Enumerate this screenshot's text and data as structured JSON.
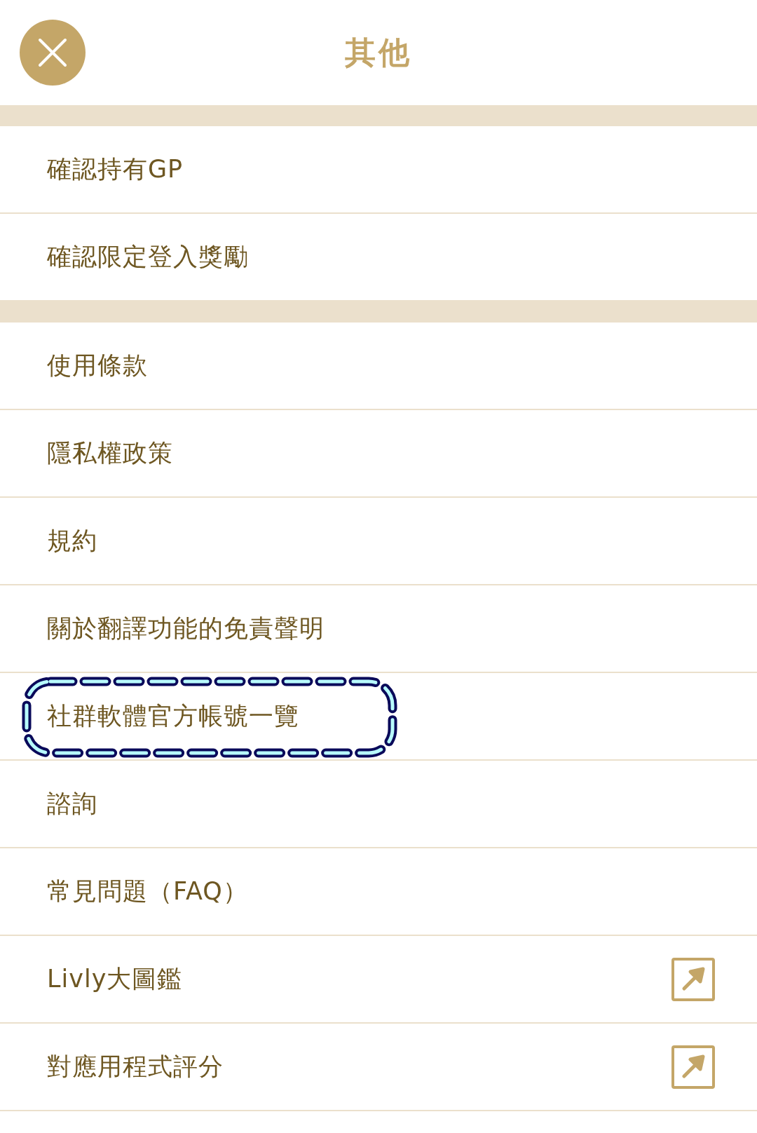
{
  "header": {
    "title": "其他"
  },
  "sections": [
    {
      "items": [
        {
          "label": "確認持有GP",
          "external": false,
          "highlighted": false
        },
        {
          "label": "確認限定登入獎勵",
          "external": false,
          "highlighted": false
        }
      ]
    },
    {
      "items": [
        {
          "label": "使用條款",
          "external": false,
          "highlighted": false
        },
        {
          "label": "隱私權政策",
          "external": false,
          "highlighted": false
        },
        {
          "label": "規約",
          "external": false,
          "highlighted": false
        },
        {
          "label": "關於翻譯功能的免責聲明",
          "external": false,
          "highlighted": false
        },
        {
          "label": "社群軟體官方帳號一覽",
          "external": false,
          "highlighted": true
        },
        {
          "label": "諮詢",
          "external": false,
          "highlighted": false
        },
        {
          "label": "常見問題（FAQ）",
          "external": false,
          "highlighted": false
        },
        {
          "label": "Livly大圖鑑",
          "external": true,
          "highlighted": false
        },
        {
          "label": "對應用程式評分",
          "external": true,
          "highlighted": false
        }
      ]
    }
  ]
}
